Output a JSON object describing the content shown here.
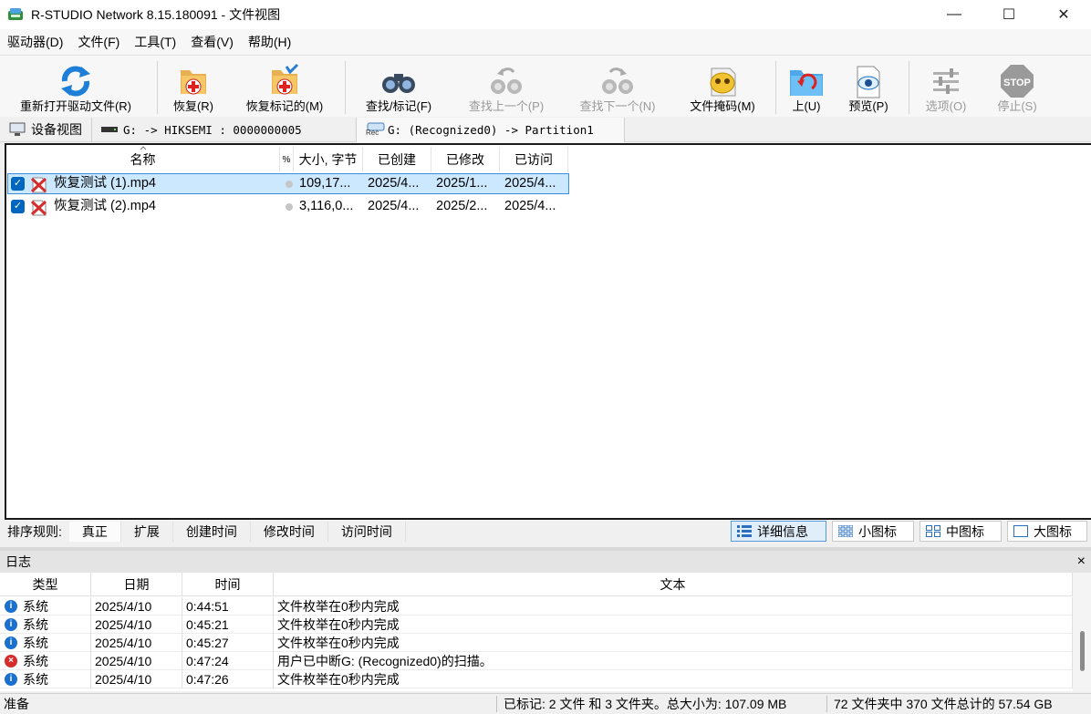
{
  "window": {
    "title": "R-STUDIO Network 8.15.180091 - 文件视图",
    "minimize": "—",
    "maximize": "☐",
    "close": "✕"
  },
  "menu": [
    "驱动器(D)",
    "文件(F)",
    "工具(T)",
    "查看(V)",
    "帮助(H)"
  ],
  "toolbar": {
    "reopen": "重新打开驱动文件(R)",
    "recover": "恢复(R)",
    "recover_marked": "恢复标记的(M)",
    "find_mark": "查找/标记(F)",
    "find_prev": "查找上一个(P)",
    "find_next": "查找下一个(N)",
    "file_mask": "文件掩码(M)",
    "up": "上(U)",
    "preview": "预览(P)",
    "options": "选项(O)",
    "stop": "停止(S)",
    "stop_icon_text": "STOP"
  },
  "path": {
    "device_view": "设备视图",
    "drive": "G: -> HIKSEMI : 0000000005",
    "partition": "G: (Recognized0) -> Partition1",
    "rec_badge": "Rec"
  },
  "files": {
    "columns": [
      "名称",
      "%",
      "大小, 字节",
      "已创建",
      "已修改",
      "已访问"
    ],
    "rows": [
      {
        "name": "恢复测试 (1).mp4",
        "size": "109,17...",
        "created": "2025/4...",
        "modified": "2025/1...",
        "accessed": "2025/4...",
        "checked": "✓",
        "selected": true
      },
      {
        "name": "恢复测试 (2).mp4",
        "size": "3,116,0...",
        "created": "2025/4...",
        "modified": "2025/2...",
        "accessed": "2025/4...",
        "checked": "✓",
        "selected": false
      }
    ]
  },
  "sort": {
    "label": "排序规则:",
    "options": [
      "真正",
      "扩展",
      "创建时间",
      "修改时间",
      "访问时间"
    ]
  },
  "views": {
    "details": "详细信息",
    "small": "小图标",
    "medium": "中图标",
    "large": "大图标"
  },
  "log": {
    "title": "日志",
    "close": "×",
    "columns": [
      "类型",
      "日期",
      "时间",
      "文本"
    ],
    "rows": [
      {
        "icon": "info",
        "type": "系统",
        "date": "2025/4/10",
        "time": "0:44:51",
        "text": "文件枚举在0秒内完成"
      },
      {
        "icon": "info",
        "type": "系统",
        "date": "2025/4/10",
        "time": "0:45:21",
        "text": "文件枚举在0秒内完成"
      },
      {
        "icon": "info",
        "type": "系统",
        "date": "2025/4/10",
        "time": "0:45:27",
        "text": "文件枚举在0秒内完成"
      },
      {
        "icon": "err",
        "type": "系统",
        "date": "2025/4/10",
        "time": "0:47:24",
        "text": "用户已中断G: (Recognized0)的扫描。"
      },
      {
        "icon": "info",
        "type": "系统",
        "date": "2025/4/10",
        "time": "0:47:26",
        "text": "文件枚举在0秒内完成"
      }
    ]
  },
  "status": {
    "ready": "准备",
    "marked": "已标记: 2 文件 和 3 文件夹。总大小为: 107.09 MB",
    "total": "72 文件夹中 370 文件总计的 57.54 GB"
  },
  "colors": {
    "selection": "#cce8ff",
    "accent": "#0067c0",
    "error": "#d62c2c"
  }
}
